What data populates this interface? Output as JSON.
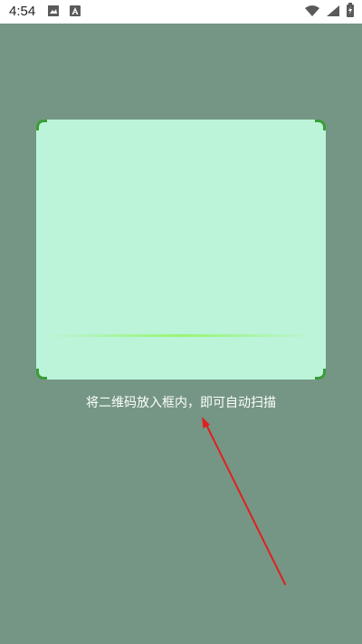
{
  "status_bar": {
    "time": "4:54",
    "icons": {
      "left": [
        "image-icon",
        "a-letter-icon"
      ],
      "right": [
        "wifi-icon",
        "signal-icon",
        "battery-icon"
      ]
    },
    "colors": {
      "icon": "#5a5a5a",
      "text": "#222222"
    }
  },
  "scanner": {
    "hint": "将二维码放入框内，即可自动扫描",
    "colors": {
      "background": "#759684",
      "frame_fill": "#bcf4d9",
      "corner": "#3a9d3a",
      "scan_line": "#96f56e",
      "hint_text": "#ffffff"
    }
  },
  "annotation": {
    "arrow_color": "#e02020"
  }
}
